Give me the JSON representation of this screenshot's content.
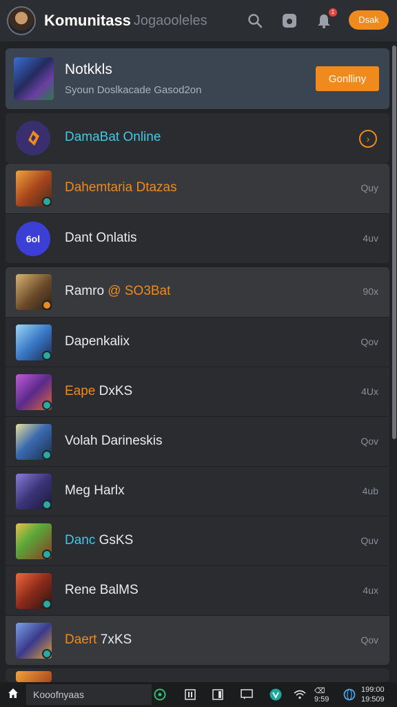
{
  "header": {
    "title": "Komunitass",
    "subtitle": "Jogaooleles",
    "pill_label": "Dsak",
    "notification_count": "1"
  },
  "featured": {
    "title": "Notkkls",
    "subtitle": "Syoun Doslkacade Gasod2on",
    "button_label": "Gonlliny"
  },
  "groups": [
    {
      "rows": [
        {
          "name": "DamaBat Online",
          "name_color": "#42c8e6",
          "time": "",
          "icon": "game-emblem-icon"
        }
      ]
    },
    {
      "rows": [
        {
          "name": "Dahemtaria Dtazas",
          "name_color": "#f08a1c",
          "time": "Quy",
          "icon": "game-thumbnail"
        },
        {
          "name": "Dant Onlatis",
          "name_color": "#e9ecef",
          "time": "4uv",
          "icon": "circle-logo",
          "circle_text": "6ol"
        }
      ]
    },
    {
      "rows": [
        {
          "name_prefix": "Ramro",
          "name_suffix": "@ SO3Bat",
          "time": "90x"
        },
        {
          "name_prefix": "Dapenkalix",
          "name_suffix": "",
          "time": "Qov"
        },
        {
          "name_prefix": "Eape",
          "name_suffix": "DxKS",
          "time": "4Ux"
        },
        {
          "name_prefix": "Volah Darineskis",
          "name_suffix": "",
          "time": "Qov"
        },
        {
          "name_prefix": "Meg Harlx",
          "name_suffix": "",
          "time": "4ub"
        },
        {
          "name_prefix": "Danc",
          "name_suffix": "GsKS",
          "time": "Quv"
        },
        {
          "name_prefix": "Rene BalMS",
          "name_suffix": "",
          "time": "4ux"
        },
        {
          "name_prefix": "Daert",
          "name_suffix": "7xKS",
          "time": "Qov"
        }
      ]
    }
  ],
  "taskbar": {
    "search_label": "Kooofnyaas",
    "clock_time": "199:00",
    "clock_date": "19:509"
  },
  "colors": {
    "accent": "#f08a1c",
    "cyan": "#42c8e6",
    "background": "#222326",
    "card": "#3b4451"
  }
}
